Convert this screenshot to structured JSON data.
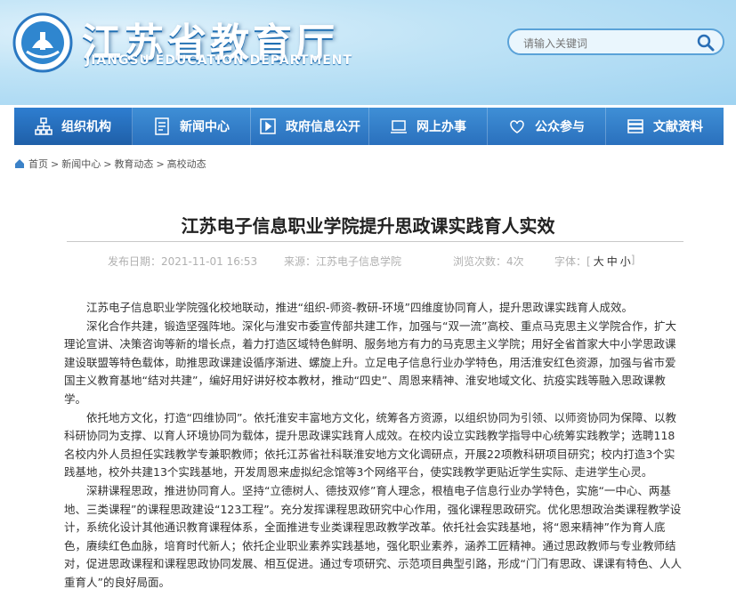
{
  "header": {
    "title_cn": "江苏省教育厅",
    "title_en": "JIANGSU EDUCATION DEPARTMENT",
    "search_placeholder": "请输入关键词"
  },
  "nav": [
    {
      "label": "组织机构",
      "icon": "org-chart-icon"
    },
    {
      "label": "新闻中心",
      "icon": "document-icon"
    },
    {
      "label": "政府信息公开",
      "icon": "info-icon"
    },
    {
      "label": "网上办事",
      "icon": "laptop-icon"
    },
    {
      "label": "公众参与",
      "icon": "chat-icon"
    },
    {
      "label": "文献资料",
      "icon": "books-icon"
    }
  ],
  "breadcrumb": [
    "首页",
    "新闻中心",
    "教育动态",
    "高校动态"
  ],
  "article": {
    "title": "江苏电子信息职业学院提升思政课实践育人实效",
    "publish_date": "发布日期：2021-11-01 16:53",
    "source": "来源：江苏电子信息学院",
    "views": "浏览次数：4次",
    "font_label": "字体：[",
    "font_big": "大",
    "font_mid": "中",
    "font_small": "小",
    "font_end": "]",
    "paragraphs": [
      "江苏电子信息职业学院强化校地联动，推进“组织-师资-教研-环境”四维度协同育人，提升思政课实践育人成效。",
      "深化合作共建，锻造坚强阵地。深化与淮安市委宣传部共建工作，加强与“双一流”高校、重点马克思主义学院合作，扩大理论宣讲、决策咨询等新的增长点，着力打造区域特色鲜明、服务地方有力的马克思主义学院；用好全省首家大中小学思政课建设联盟等特色载体，助推思政课建设循序渐进、螺旋上升。立足电子信息行业办学特色，用活淮安红色资源，加强与省市爱国主义教育基地“结对共建”，编好用好讲好校本教材，推动“四史”、周恩来精神、淮安地域文化、抗疫实践等融入思政课教学。",
      "依托地方文化，打造“四维协同”。依托淮安丰富地方文化，统筹各方资源，以组织协同为引领、以师资协同为保障、以教科研协同为支撑、以育人环境协同为载体，提升思政课实践育人成效。在校内设立实践教学指导中心统筹实践教学；选聘118名校内外人员担任实践教学专兼职教师；依托江苏省社科联淮安地方文化调研点，开展22项教科研项目研究；校内打造3个实践基地，校外共建13个实践基地，开发周恩来虚拟纪念馆等3个网络平台，使实践教学更贴近学生实际、走进学生心灵。",
      "深耕课程思政，推进协同育人。坚持“立德树人、德技双修”育人理念，根植电子信息行业办学特色，实施“一中心、两基地、三类课程”的课程思政建设“123工程”。充分发挥课程思政研究中心作用，强化课程思政研究。优化思想政治类课程教学设计，系统化设计其他通识教育课程体系，全面推进专业类课程思政教学改革。依托社会实践基地，将“恩来精神”作为育人底色，赓续红色血脉，培育时代新人；依托企业职业素养实践基地，强化职业素养，涵养工匠精神。通过思政教师与专业教师结对，促进思政课程和课程思政协同发展、相互促进。通过专项研究、示范项目典型引路，形成“门门有思政、课课有特色、人人重育人”的良好局面。"
    ]
  }
}
